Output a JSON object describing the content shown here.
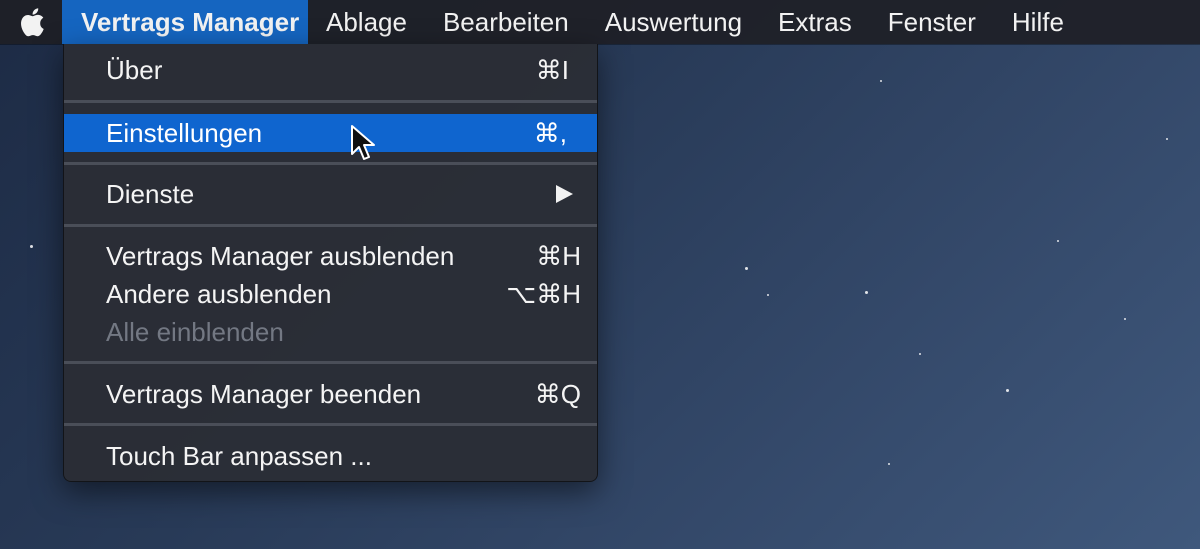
{
  "menubar": {
    "apple_icon": "apple-logo-icon",
    "items": [
      {
        "label": "Vertrags Manager"
      },
      {
        "label": "Ablage"
      },
      {
        "label": "Bearbeiten"
      },
      {
        "label": "Auswertung"
      },
      {
        "label": "Extras"
      },
      {
        "label": "Fenster"
      },
      {
        "label": "Hilfe"
      }
    ]
  },
  "app_menu": {
    "items": [
      {
        "label": "Über",
        "shortcut": "⌘I"
      },
      {
        "label": "Einstellungen",
        "shortcut": "⌘,",
        "state": "highlighted"
      },
      {
        "label": "Dienste",
        "shortcut": "",
        "submenu_icon": "triangle-right-icon"
      },
      {
        "label": "Vertrags Manager ausblenden",
        "shortcut": "⌘H"
      },
      {
        "label": "Andere ausblenden",
        "shortcut": "⌥⌘H"
      },
      {
        "label": "Alle einblenden",
        "shortcut": "",
        "state": "disabled"
      },
      {
        "label": "Vertrags Manager beenden",
        "shortcut": "⌘Q"
      },
      {
        "label": "Touch Bar anpassen ...",
        "shortcut": ""
      }
    ]
  },
  "colors": {
    "highlight": "#0f65cf",
    "menubar_active": "#1565c0",
    "disabled_text": "#737883"
  },
  "cursor_icon": "arrow-pointer-icon"
}
